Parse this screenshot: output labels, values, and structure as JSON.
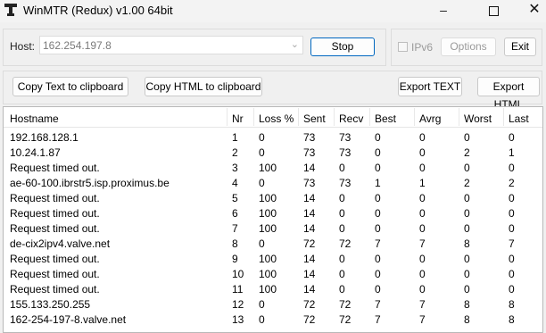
{
  "window": {
    "title": "WinMTR (Redux) v1.00 64bit",
    "minimize": "–",
    "close": "✕"
  },
  "host": {
    "label": "Host:",
    "value": "162.254.197.8"
  },
  "buttons": {
    "stop": "Stop",
    "options": "Options",
    "exit": "Exit",
    "copy_text": "Copy Text to clipboard",
    "copy_html": "Copy HTML to clipboard",
    "export_text": "Export TEXT",
    "export_html": "Export HTML"
  },
  "ipv6": {
    "label": "IPv6",
    "checked": false
  },
  "table": {
    "headers": [
      "Hostname",
      "Nr",
      "Loss %",
      "Sent",
      "Recv",
      "Best",
      "Avrg",
      "Worst",
      "Last"
    ],
    "rows": [
      [
        "192.168.128.1",
        "1",
        "0",
        "73",
        "73",
        "0",
        "0",
        "0",
        "0"
      ],
      [
        "10.24.1.87",
        "2",
        "0",
        "73",
        "73",
        "0",
        "0",
        "2",
        "1"
      ],
      [
        "Request timed out.",
        "3",
        "100",
        "14",
        "0",
        "0",
        "0",
        "0",
        "0"
      ],
      [
        "ae-60-100.ibrstr5.isp.proximus.be",
        "4",
        "0",
        "73",
        "73",
        "1",
        "1",
        "2",
        "2"
      ],
      [
        "Request timed out.",
        "5",
        "100",
        "14",
        "0",
        "0",
        "0",
        "0",
        "0"
      ],
      [
        "Request timed out.",
        "6",
        "100",
        "14",
        "0",
        "0",
        "0",
        "0",
        "0"
      ],
      [
        "Request timed out.",
        "7",
        "100",
        "14",
        "0",
        "0",
        "0",
        "0",
        "0"
      ],
      [
        "de-cix2ipv4.valve.net",
        "8",
        "0",
        "72",
        "72",
        "7",
        "7",
        "8",
        "7"
      ],
      [
        "Request timed out.",
        "9",
        "100",
        "14",
        "0",
        "0",
        "0",
        "0",
        "0"
      ],
      [
        "Request timed out.",
        "10",
        "100",
        "14",
        "0",
        "0",
        "0",
        "0",
        "0"
      ],
      [
        "Request timed out.",
        "11",
        "100",
        "14",
        "0",
        "0",
        "0",
        "0",
        "0"
      ],
      [
        "155.133.250.255",
        "12",
        "0",
        "72",
        "72",
        "7",
        "7",
        "8",
        "8"
      ],
      [
        "162-254-197-8.valve.net",
        "13",
        "0",
        "72",
        "72",
        "7",
        "7",
        "8",
        "8"
      ]
    ]
  },
  "colors": {
    "accent": "#0067c0",
    "background": "#f0f0f0",
    "disabled_text": "#9a9a9a"
  }
}
